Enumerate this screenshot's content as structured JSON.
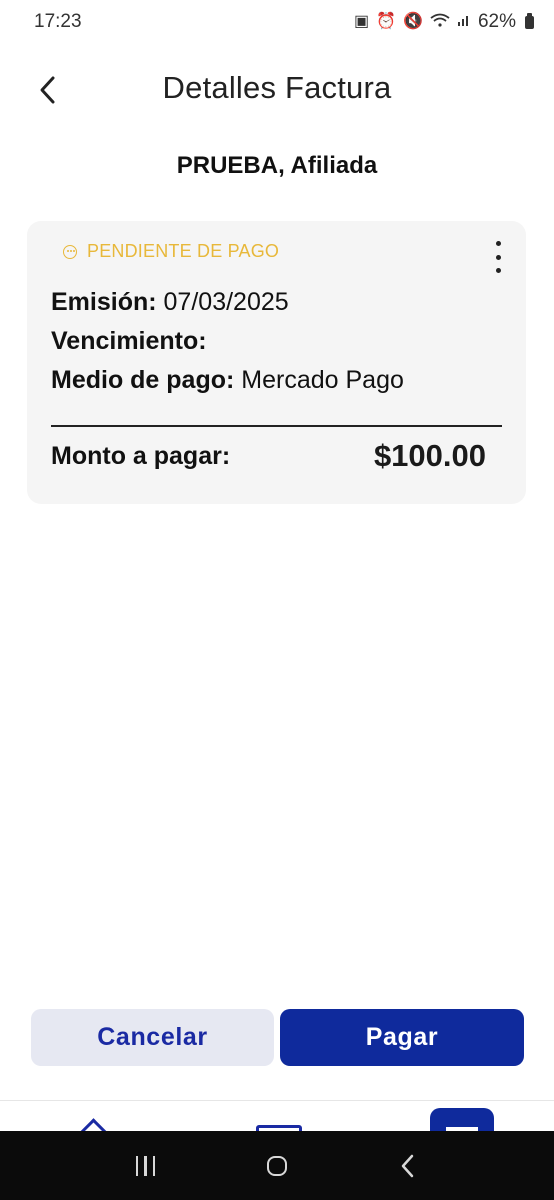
{
  "status_bar": {
    "time": "17:23",
    "battery": "62%",
    "icons": [
      "sim-icon",
      "alarm-icon",
      "mute-icon",
      "wifi-icon",
      "signal-icon",
      "battery-icon"
    ]
  },
  "header": {
    "title": "Detalles Factura",
    "back_icon": "chevron-left-icon"
  },
  "subtitle": "PRUEBA, Afiliada",
  "invoice": {
    "status": "PENDIENTE DE PAGO",
    "status_color": "#E8B83A",
    "emision_label": "Emisión:",
    "emision_value": "07/03/2025",
    "vencimiento_label": "Vencimiento:",
    "vencimiento_value": "",
    "medio_label": "Medio de pago:",
    "medio_value": "Mercado Pago",
    "monto_label": "Monto a pagar:",
    "monto_value": "$100.00"
  },
  "actions": {
    "cancel_label": "Cancelar",
    "pay_label": "Pagar"
  },
  "colors": {
    "primary": "#0F2A9C",
    "cancel_bg": "#E6E8F2",
    "card_bg": "#F5F5F5"
  }
}
